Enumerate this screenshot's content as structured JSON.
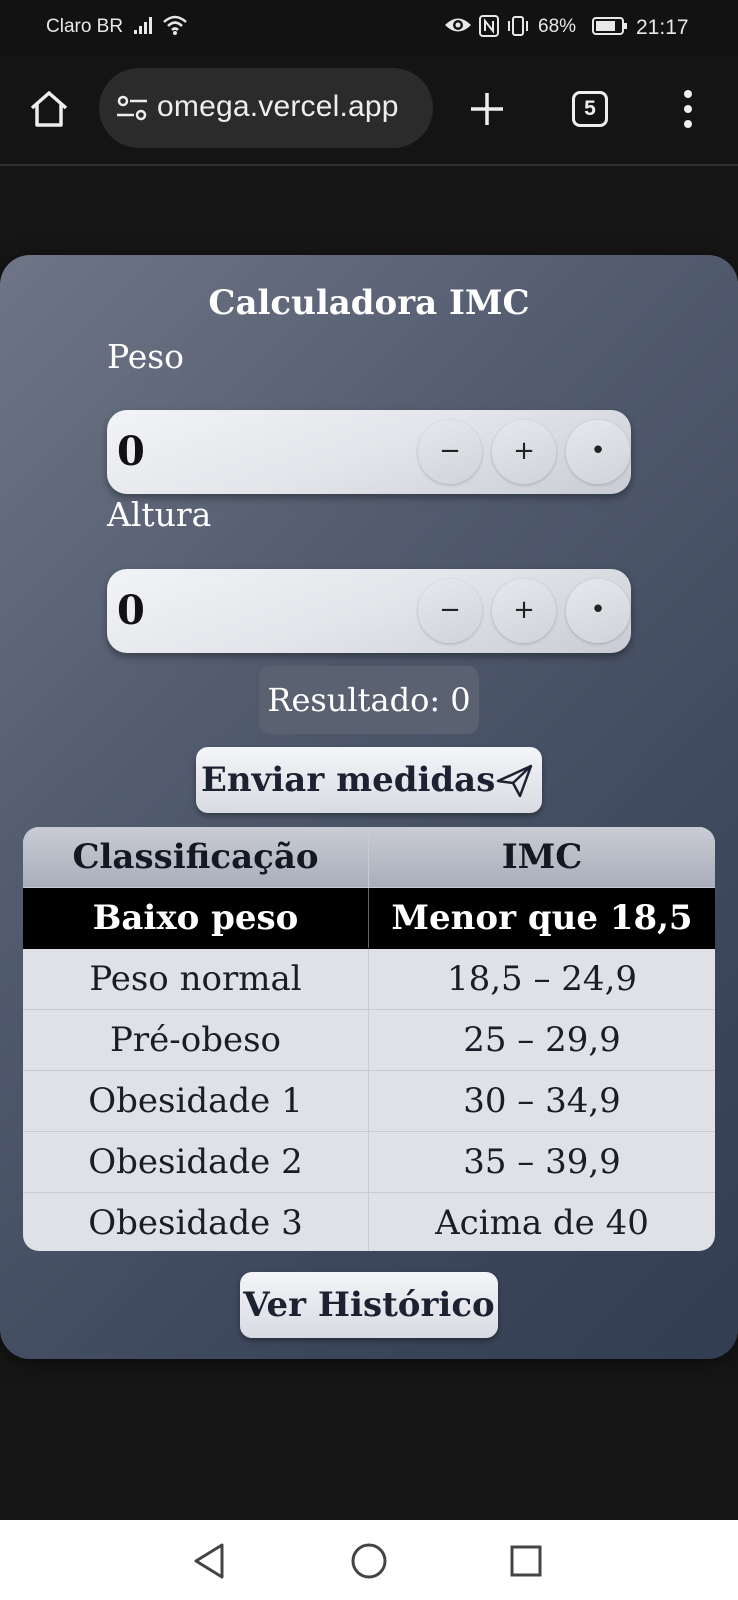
{
  "status_bar": {
    "carrier": "Claro BR",
    "battery": "68%",
    "time": "21:17"
  },
  "browser": {
    "url": "omega.vercel.app",
    "tab_count": "5"
  },
  "calculator": {
    "title": "Calculadora IMC",
    "peso_label": "Peso",
    "peso_value": "0",
    "altura_label": "Altura",
    "altura_value": "0",
    "minus": "−",
    "plus": "+",
    "dot": "•",
    "result_text": "Resultado: 0",
    "send_label": "Enviar medidas",
    "history_label": "Ver Histórico"
  },
  "table": {
    "headers": [
      "Classificação",
      "IMC"
    ],
    "rows": [
      {
        "class": "Baixo peso",
        "imc": "Menor que 18,5",
        "highlighted": true
      },
      {
        "class": "Peso normal",
        "imc": "18,5 – 24,9"
      },
      {
        "class": "Pré-obeso",
        "imc": "25 – 29,9"
      },
      {
        "class": "Obesidade 1",
        "imc": "30 – 34,9"
      },
      {
        "class": "Obesidade 2",
        "imc": "35 – 39,9"
      },
      {
        "class": "Obesidade 3",
        "imc": "Acima de 40"
      }
    ]
  },
  "icons": {
    "status": [
      "signal-icon",
      "wifi-icon",
      "eye-icon",
      "nfc-icon",
      "vibrate-icon",
      "battery-icon"
    ],
    "browser": [
      "home-icon",
      "tune-icon",
      "plus-icon",
      "tabs-icon",
      "more-vert-icon"
    ],
    "nav": [
      "back-icon",
      "home-circle-icon",
      "recents-icon"
    ],
    "send": "send-icon"
  },
  "colors": {
    "highlight_row": "#000000",
    "card_gradient_start": "#6e7586",
    "card_gradient_end": "#333d51"
  }
}
